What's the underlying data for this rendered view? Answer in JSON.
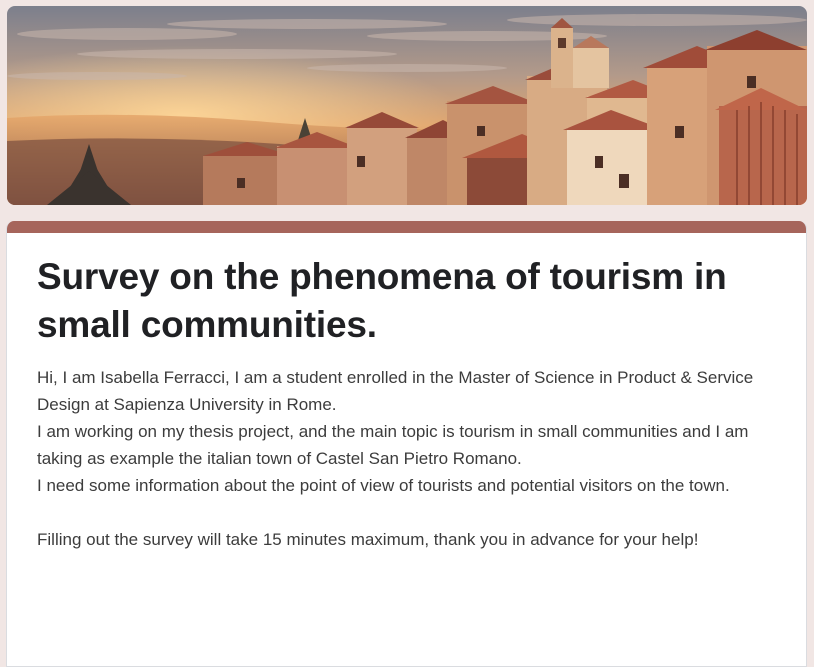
{
  "form": {
    "title": "Survey on the phenomena of tourism in small communities.",
    "description_lines": [
      "Hi, I am Isabella Ferracci, I am a student enrolled in the Master of Science in Product & Service Design at Sapienza University in Rome.",
      "I am working on my thesis project, and the main topic is tourism in small communities and I am taking as example the italian town of Castel San Pietro Romano.",
      "I need some information about the point of view of tourists and potential visitors on the town."
    ],
    "closing_line": "Filling out the survey will take 15 minutes maximum, thank you in advance for your help!"
  },
  "theme": {
    "accent_color": "#a6655b",
    "page_background": "#f1e6e4",
    "card_background": "#ffffff",
    "title_color": "#202124",
    "text_color": "#3c3c3c"
  },
  "header_image": {
    "subject": "hilltop-town-at-sunset-photo"
  }
}
